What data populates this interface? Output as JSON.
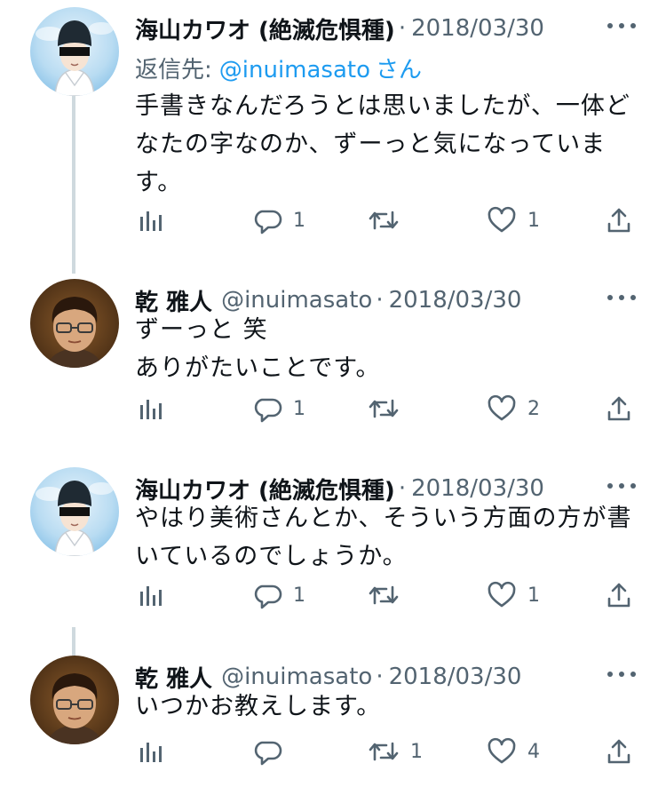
{
  "thread": {
    "tweets": [
      {
        "display_name": "海山カワオ (絶滅危惧種)",
        "handle": "",
        "dot": "·",
        "date": "2018/03/30",
        "reply_prefix": "返信先:",
        "reply_mention": "@inuimasato",
        "reply_suffix": "さん",
        "text_lines": [
          "手書きなんだろうとは思いましたが、一体ど",
          "なたの字なのか、ずーっと気になっていま",
          "す。"
        ],
        "reply_count": "1",
        "retweet_count": "",
        "like_count": "1"
      },
      {
        "display_name": "乾 雅人",
        "handle": "@inuimasato",
        "dot": "·",
        "date": "2018/03/30",
        "text_lines": [
          "ずーっと 笑",
          "ありがたいことです。"
        ],
        "reply_count": "1",
        "retweet_count": "",
        "like_count": "2"
      },
      {
        "display_name": "海山カワオ (絶滅危惧種)",
        "handle": "",
        "dot": "·",
        "date": "2018/03/30",
        "text_lines": [
          "やはり美術さんとか、そういう方面の方が書",
          "いているのでしょうか。"
        ],
        "reply_count": "1",
        "retweet_count": "",
        "like_count": "1"
      },
      {
        "display_name": "乾 雅人",
        "handle": "@inuimasato",
        "dot": "·",
        "date": "2018/03/30",
        "text_lines": [
          "いつかお教えします。"
        ],
        "reply_count": "",
        "retweet_count": "1",
        "like_count": "4"
      }
    ]
  },
  "icons": {
    "analytics": "bar-chart-icon",
    "reply": "speech-bubble-icon",
    "retweet": "retweet-arrows-icon",
    "like": "heart-outline-icon",
    "share": "share-upload-icon",
    "more": "more-dots-icon"
  },
  "colors": {
    "text_primary": "#0f1419",
    "text_secondary": "#536471",
    "link": "#1d9bf0",
    "thread_line": "#cfd9de",
    "background": "#ffffff"
  }
}
